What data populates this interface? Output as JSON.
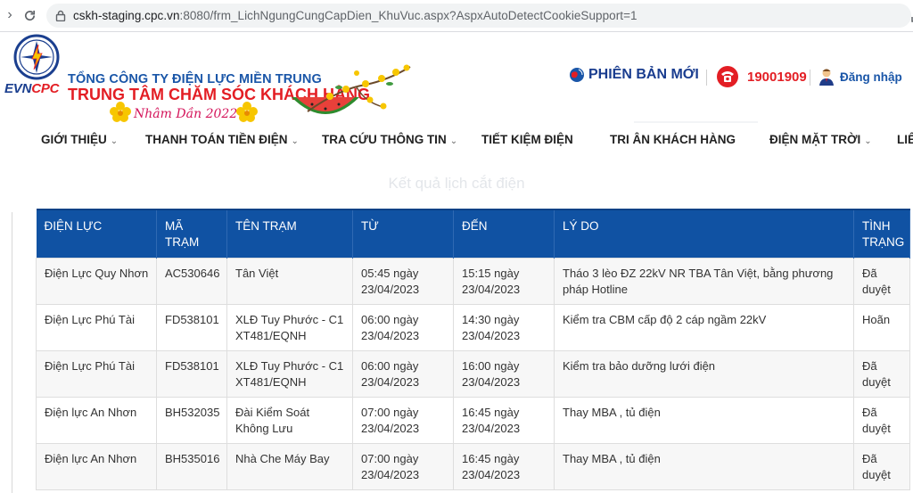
{
  "browser": {
    "url_host": "cskh-staging.cpc.vn",
    "url_path": ":8080/frm_LichNgungCungCapDien_KhuVuc.aspx?AspxAutoDetectCookieSupport=1"
  },
  "header": {
    "brand_evn": "EVN",
    "brand_cpc": "CPC",
    "company_line1": "TỔNG CÔNG TY ĐIỆN LỰC MIỀN TRUNG",
    "company_line2": "TRUNG TÂM CHĂM SÓC KHÁCH HÀNG",
    "tet_text": "Nhâm Dần 2022",
    "new_version": "PHIÊN BẢN MỚI",
    "hotline": "19001909",
    "login": "Đăng nhập"
  },
  "nav": {
    "items": [
      {
        "label": "GIỚI THIỆU",
        "dropdown": true
      },
      {
        "label": "THANH TOÁN TIỀN ĐIỆN",
        "dropdown": true
      },
      {
        "label": "TRA CỨU THÔNG TIN",
        "dropdown": true
      },
      {
        "label": "TIẾT KIỆM ĐIỆN",
        "dropdown": false
      },
      {
        "label": "TRI ÂN KHÁCH HÀNG",
        "dropdown": false
      },
      {
        "label": "ĐIỆN MẶT TRỜI",
        "dropdown": true
      },
      {
        "label": "LIÊ",
        "dropdown": false
      }
    ]
  },
  "page": {
    "title": "Kết quả lịch cắt điện"
  },
  "table": {
    "headers": [
      "ĐIỆN LỰC",
      "MÃ TRẠM",
      "TÊN TRẠM",
      "TỪ",
      "ĐẾN",
      "LÝ DO",
      "TÌNH TRẠNG"
    ],
    "rows": [
      [
        "Điện Lực Quy Nhơn",
        "AC530646",
        "Tân Việt",
        "05:45 ngày 23/04/2023",
        "15:15 ngày 23/04/2023",
        "Tháo 3 lèo ĐZ 22kV NR TBA Tân Việt, bằng phương pháp Hotline",
        "Đã duyệt"
      ],
      [
        "Điện Lực Phú Tài",
        "FD538101",
        "XLĐ Tuy Phước - C1 XT481/EQNH",
        "06:00 ngày 23/04/2023",
        "14:30 ngày 23/04/2023",
        "Kiểm tra CBM cấp độ 2 cáp ngầm 22kV",
        "Hoãn"
      ],
      [
        "Điện Lực Phú Tài",
        "FD538101",
        "XLĐ Tuy Phước - C1 XT481/EQNH",
        "06:00 ngày 23/04/2023",
        "16:00 ngày 23/04/2023",
        "Kiểm tra bảo dưỡng lưới điện",
        "Đã duyệt"
      ],
      [
        "Điện lực An Nhơn",
        "BH532035",
        "Đài Kiểm Soát Không Lưu",
        "07:00 ngày 23/04/2023",
        "16:45 ngày 23/04/2023",
        "Thay MBA , tủ điện",
        "Đã duyệt"
      ],
      [
        "Điện lực An Nhơn",
        "BH535016",
        "Nhà Che Máy Bay",
        "07:00 ngày 23/04/2023",
        "16:45 ngày 23/04/2023",
        "Thay MBA , tủ điện",
        "Đã duyệt"
      ]
    ]
  },
  "colors": {
    "table_header_bg": "#1052a3",
    "brand_blue": "#1a56a8",
    "brand_red": "#e31e24"
  }
}
